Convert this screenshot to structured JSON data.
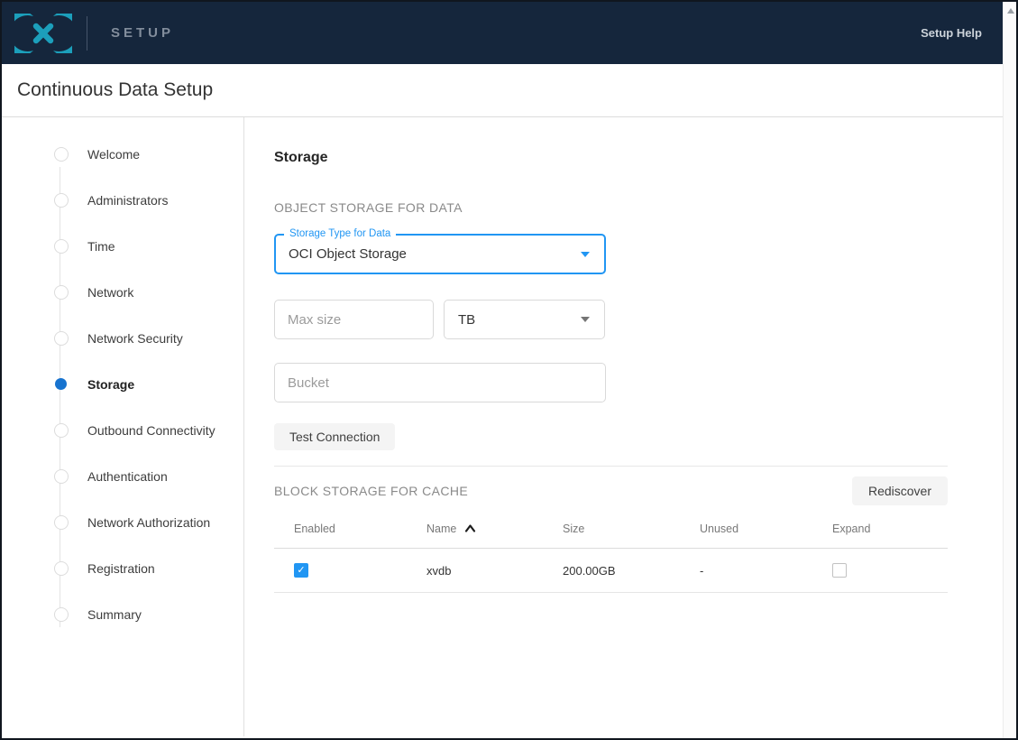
{
  "header": {
    "product_name": "SETUP",
    "help_link": "Setup Help",
    "logo": "delphix-infinity-mark",
    "bg_color": "#15263C",
    "logo_color": "#1C9FBB"
  },
  "page": {
    "title": "Continuous Data Setup"
  },
  "sidebar": {
    "steps": [
      {
        "label": "Welcome",
        "active": false
      },
      {
        "label": "Administrators",
        "active": false
      },
      {
        "label": "Time",
        "active": false
      },
      {
        "label": "Network",
        "active": false
      },
      {
        "label": "Network Security",
        "active": false
      },
      {
        "label": "Storage",
        "active": true
      },
      {
        "label": "Outbound Connectivity",
        "active": false
      },
      {
        "label": "Authentication",
        "active": false
      },
      {
        "label": "Network Authorization",
        "active": false
      },
      {
        "label": "Registration",
        "active": false
      },
      {
        "label": "Summary",
        "active": false
      }
    ],
    "active_step_color": "#1773CF"
  },
  "main": {
    "heading": "Storage",
    "object_storage": {
      "section_label": "OBJECT STORAGE FOR DATA",
      "storage_type": {
        "label": "Storage Type for Data",
        "value": "OCI Object Storage",
        "accent_color": "#2196F3"
      },
      "max_size": {
        "placeholder": "Max size",
        "value": ""
      },
      "unit": {
        "value": "TB"
      },
      "bucket": {
        "placeholder": "Bucket",
        "value": ""
      },
      "test_connection_label": "Test Connection"
    },
    "block_storage": {
      "section_label": "BLOCK STORAGE FOR CACHE",
      "rediscover_label": "Rediscover",
      "table": {
        "columns": [
          "Enabled",
          "Name",
          "Size",
          "Unused",
          "Expand"
        ],
        "sort_column": "Name",
        "sort_direction": "ascending",
        "rows": [
          {
            "enabled": true,
            "name": "xvdb",
            "size": "200.00GB",
            "unused": "-",
            "expand": false
          }
        ]
      }
    }
  }
}
